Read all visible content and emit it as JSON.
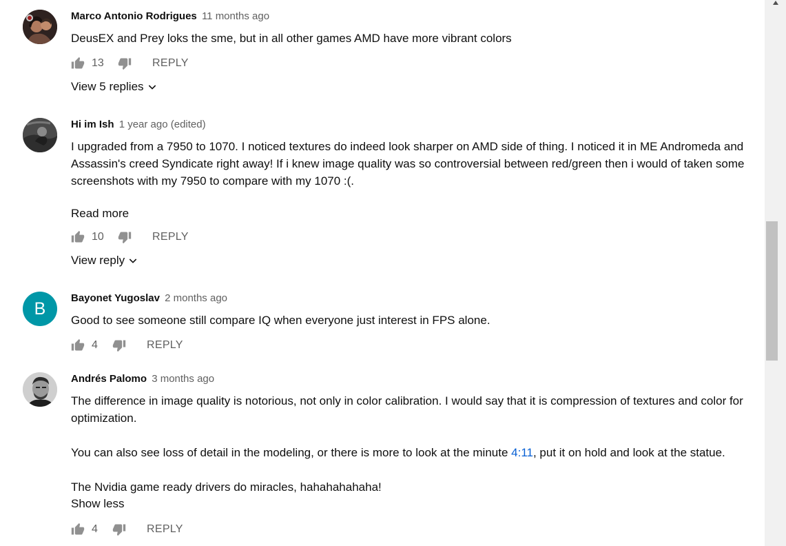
{
  "comments": [
    {
      "author": "Marco Antonio Rodrigues",
      "time": "11 months ago",
      "text": "DeusEX and Prey loks the sme, but in all other games AMD have more vibrant colors",
      "likes": "13",
      "reply": "REPLY",
      "replies_label": "View 5 replies"
    },
    {
      "author": "Hi im Ish",
      "time": "1 year ago (edited)",
      "text": "I upgraded from a 7950 to 1070. I noticed textures do indeed look sharper on AMD side of thing. I noticed it in ME Andromeda and Assassin's creed Syndicate right away! If i knew image quality was so controversial between red/green then i would of taken some screenshots with my 7950 to compare with my 1070 :(.",
      "read_more": "Read more",
      "likes": "10",
      "reply": "REPLY",
      "replies_label": "View reply"
    },
    {
      "author": "Bayonet Yugoslav",
      "time": "2 months ago",
      "avatar_letter": "B",
      "avatar_color": "#0097a7",
      "text": "Good to see someone still compare IQ when everyone just interest in FPS alone.",
      "likes": "4",
      "reply": "REPLY"
    },
    {
      "author": "Andrés Palomo",
      "time": "3 months ago",
      "text_p1": "The difference in image quality is notorious, not only in color calibration. I would say that it is compression of textures and color for optimization.",
      "text_p2_before": "You can also see loss of detail in the modeling, or there is more to look at the minute ",
      "timestamp_link": "4:11",
      "text_p2_after": ", put it on hold and look at the statue.",
      "text_p3": "The Nvidia game ready drivers do miracles, hahahahahaha!",
      "show_less": "Show less",
      "likes": "4",
      "reply": "REPLY"
    }
  ],
  "icons": {
    "like": "thumbs-up-icon",
    "dislike": "thumbs-down-icon",
    "chevron": "chevron-down-icon",
    "scroll_up": "scroll-up-arrow-icon"
  },
  "colors": {
    "link": "#065fd4",
    "secondary_text": "#606060",
    "icon": "#909090"
  }
}
